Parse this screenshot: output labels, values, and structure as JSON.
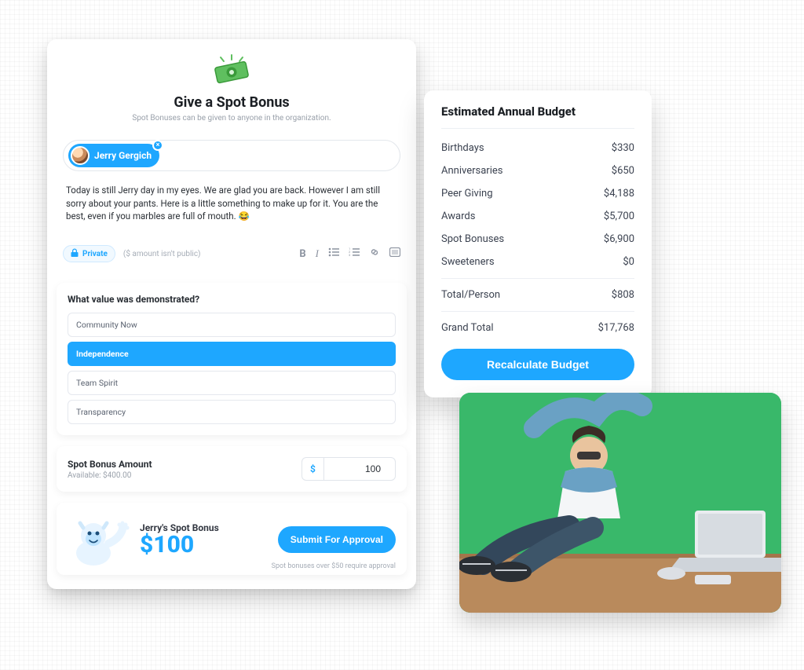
{
  "main": {
    "title": "Give a Spot Bonus",
    "subtitle": "Spot Bonuses can be given to anyone in the organization.",
    "recipient": {
      "name": "Jerry Gergich"
    },
    "message": "Today is still Jerry day in my eyes. We are glad you are back. However I am still sorry about your pants. Here is a little something to make up for it. You are the best, even if you marbles are full of mouth. 😂",
    "privacy_label": "Private",
    "privacy_hint": "($ amount isn't public)",
    "value_question": "What value was demonstrated?",
    "values": [
      {
        "label": "Community Now",
        "selected": false
      },
      {
        "label": "Independence",
        "selected": true
      },
      {
        "label": "Team Spirit",
        "selected": false
      },
      {
        "label": "Transparency",
        "selected": false
      }
    ],
    "amount": {
      "title": "Spot Bonus Amount",
      "available_label": "Available: $400.00",
      "currency_symbol": "$",
      "value": "100"
    },
    "summary": {
      "title": "Jerry's Spot Bonus",
      "amount_display": "$100",
      "submit_label": "Submit For Approval",
      "note": "Spot bonuses over $50 require approval"
    }
  },
  "budget": {
    "title": "Estimated Annual Budget",
    "items": [
      {
        "label": "Birthdays",
        "amount": "$330"
      },
      {
        "label": "Anniversaries",
        "amount": "$650"
      },
      {
        "label": "Peer Giving",
        "amount": "$4,188"
      },
      {
        "label": "Awards",
        "amount": "$5,700"
      },
      {
        "label": "Spot Bonuses",
        "amount": "$6,900"
      },
      {
        "label": "Sweeteners",
        "amount": "$0"
      }
    ],
    "per_person": {
      "label": "Total/Person",
      "amount": "$808"
    },
    "grand_total": {
      "label": "Grand Total",
      "amount": "$17,768"
    },
    "recalc_label": "Recalculate Budget"
  },
  "colors": {
    "accent": "#1ea7ff",
    "green": "#39b86a"
  }
}
